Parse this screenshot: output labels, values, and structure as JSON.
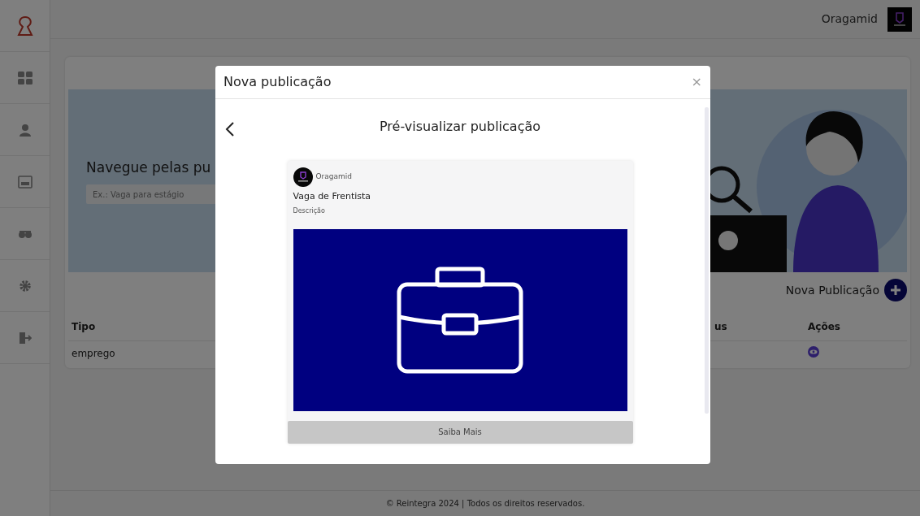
{
  "header": {
    "user_name": "Oragamid"
  },
  "banner": {
    "title": "Navegue pelas pu",
    "search": {
      "placeholder": "Ex.: Vaga para estágio"
    }
  },
  "new_post": {
    "label": "Nova Publicação"
  },
  "table": {
    "columns": [
      "Tipo",
      "us",
      "Ações"
    ],
    "rows": [
      {
        "tipo": "emprego"
      }
    ]
  },
  "footer": "© Reintegra 2024 | Todos os direitos reservados.",
  "modal": {
    "title": "Nova publicação",
    "close": "×",
    "heading": "Pré-visualizar publicação",
    "preview": {
      "author": "Oragamid",
      "title": "Vaga de Frentista",
      "description": "Descrição",
      "button": "Saiba Mais"
    }
  }
}
